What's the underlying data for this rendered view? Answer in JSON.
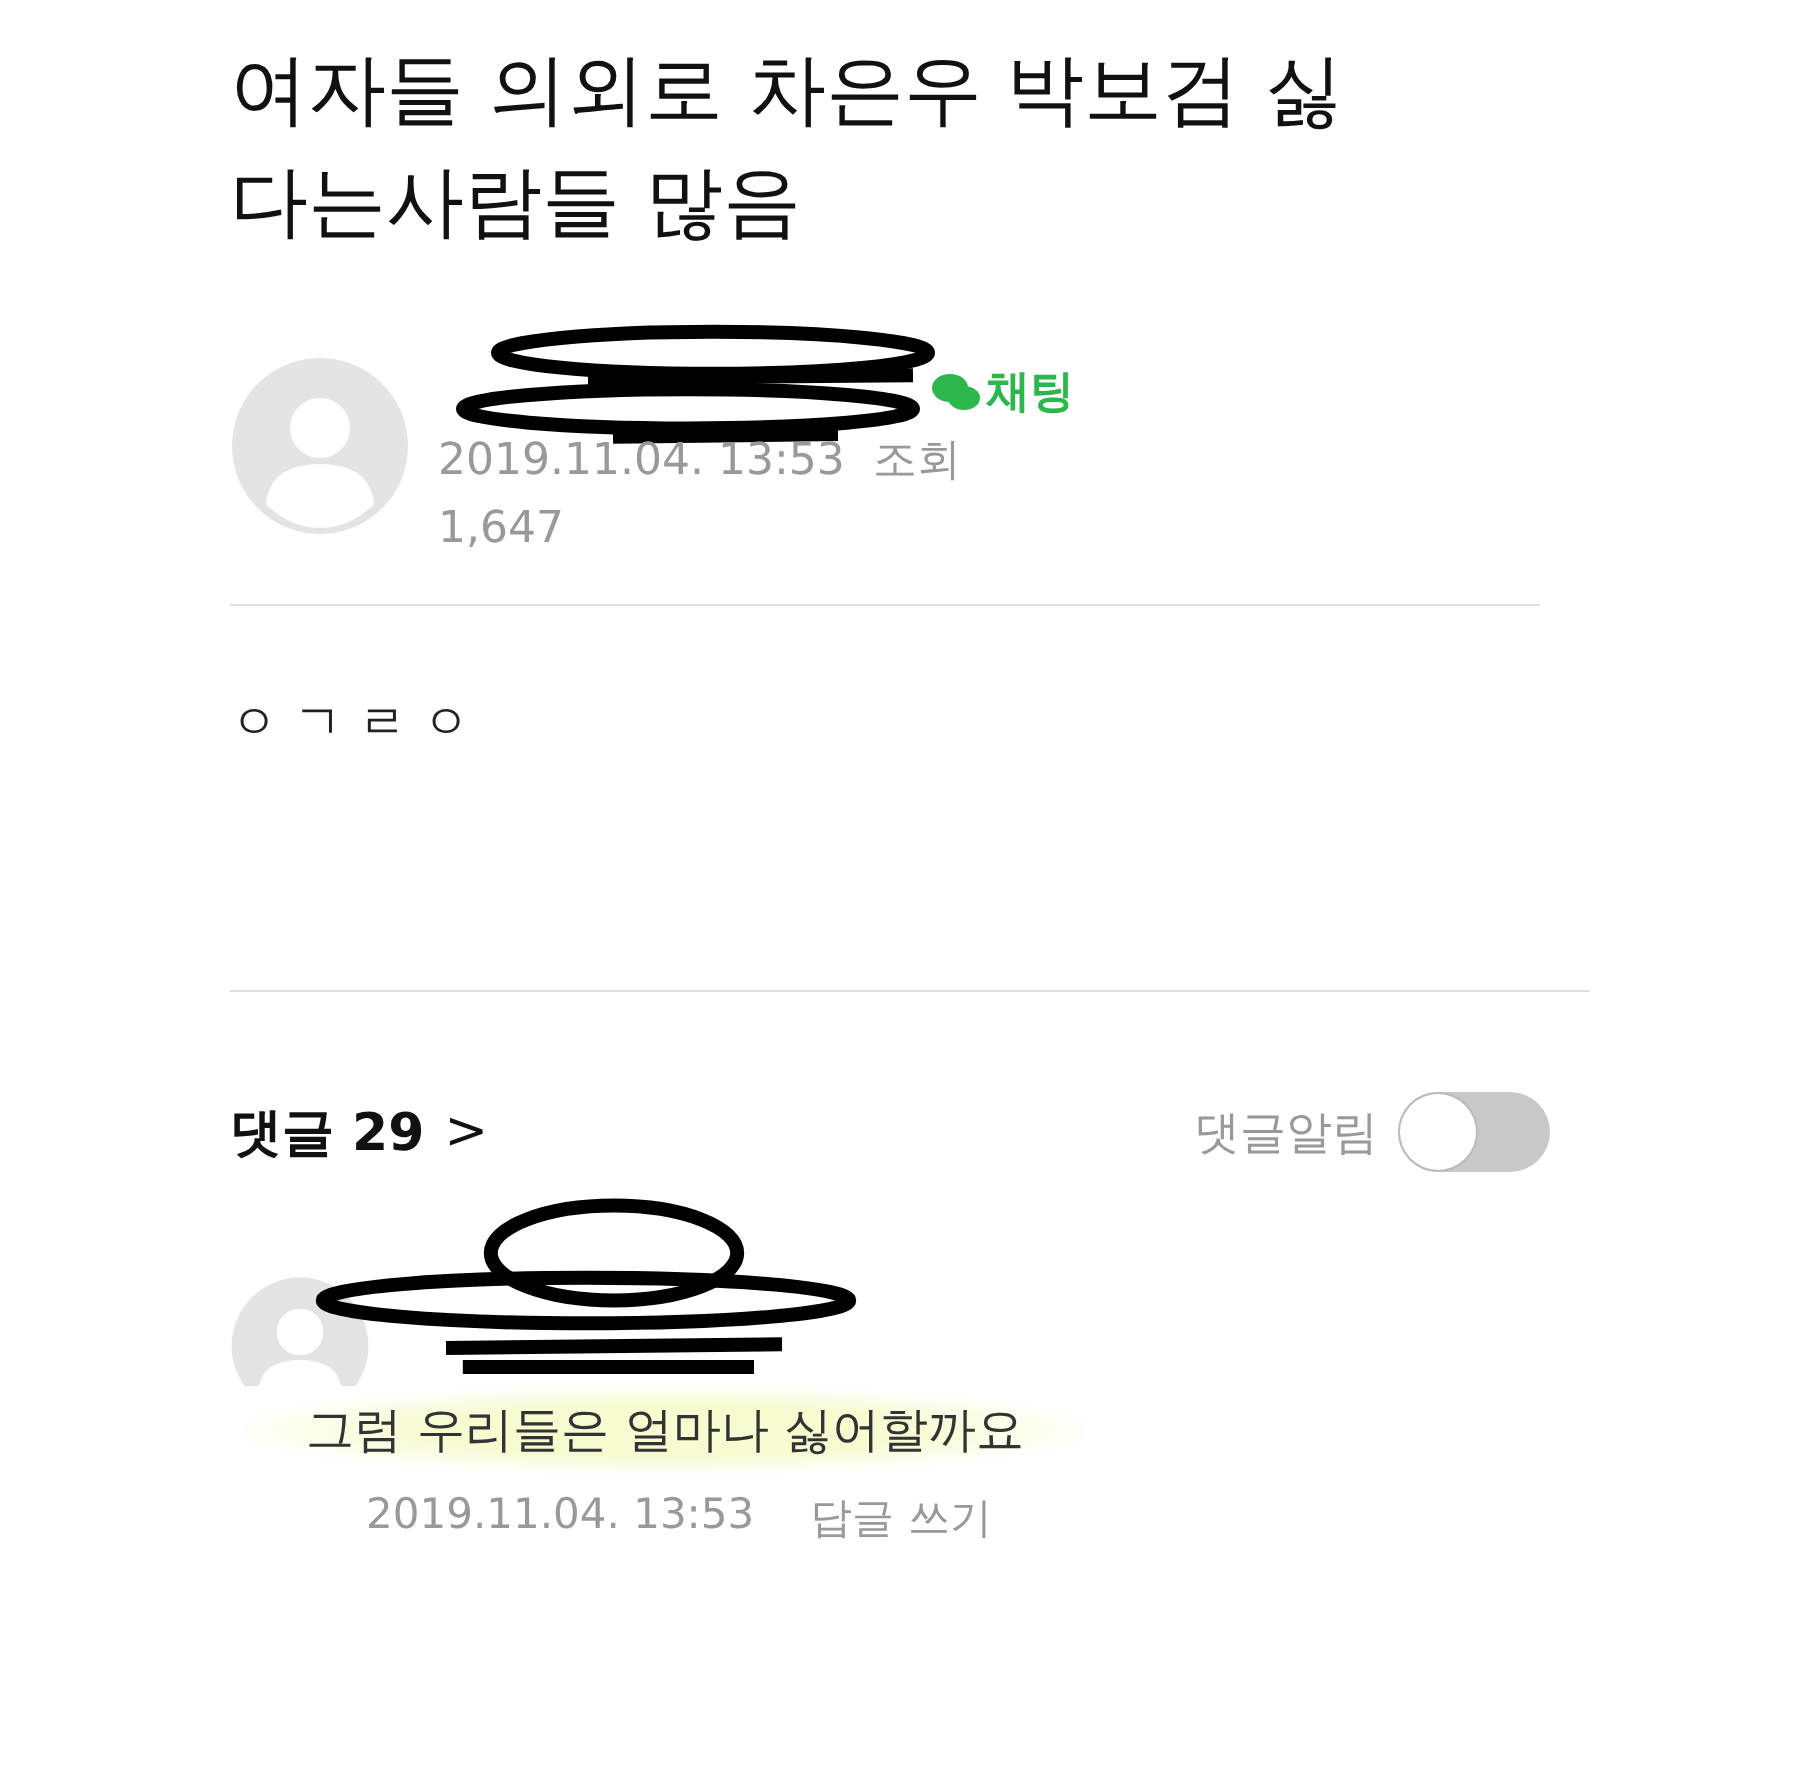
{
  "post": {
    "title": "여자들 의외로 차은우 박보검 싫다는사람들 많음",
    "author": {
      "redacted": true
    },
    "chat_label": "채팅",
    "date": "2019.11.04. 13:53",
    "views_label": "조회",
    "views": "1,647",
    "body": "ㅇㄱㄹㅇ"
  },
  "comments_header": {
    "label": "댓글 29",
    "chevron": ">",
    "notify_label": "댓글알림",
    "notify_on": false
  },
  "comments": [
    {
      "author": {
        "redacted": true
      },
      "text": "그럼 우리들은 얼마나 싫어할까요",
      "highlighted": true,
      "date": "2019.11.04. 13:53",
      "reply_label": "답글 쓰기"
    }
  ]
}
